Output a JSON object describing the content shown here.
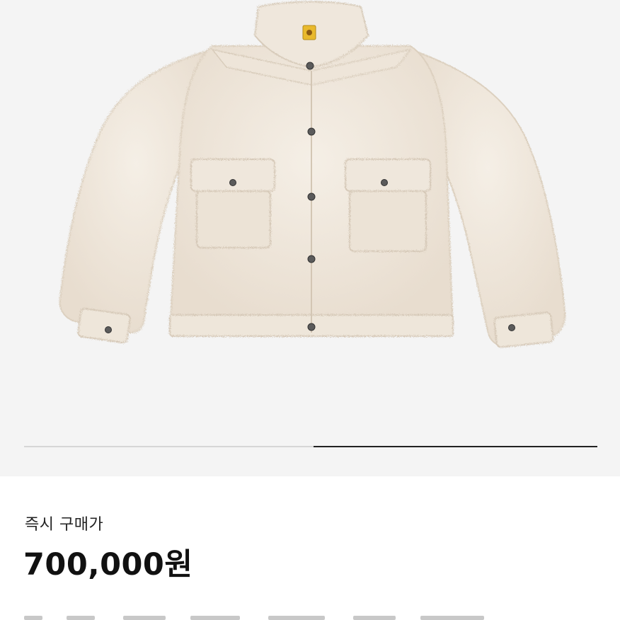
{
  "product": {
    "image_alt": "jacket-photo",
    "instant_price_label": "즉시 구매가",
    "instant_price": "700,000원"
  },
  "pager": {
    "total_pages": 2,
    "current_page": 2
  },
  "colors": {
    "image_background": "#f4f4f4",
    "pager_active": "#222222",
    "pager_inactive": "#d6d6d6",
    "fleece": "#ede4d8"
  }
}
